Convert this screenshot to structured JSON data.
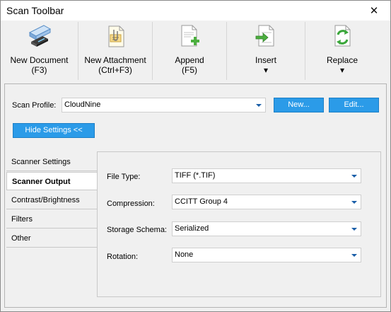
{
  "window": {
    "title": "Scan Toolbar"
  },
  "toolbar": {
    "buttons": [
      {
        "line1": "New Document",
        "line2": "(F3)",
        "icon": "scanner-icon"
      },
      {
        "line1": "New Attachment",
        "line2": "(Ctrl+F3)",
        "icon": "attachment-icon"
      },
      {
        "line1": "Append",
        "line2": "(F5)",
        "icon": "append-document-icon"
      },
      {
        "line1": "Insert",
        "line2": "▾",
        "icon": "insert-document-icon"
      },
      {
        "line1": "Replace",
        "line2": "▾",
        "icon": "replace-document-icon"
      }
    ]
  },
  "profile": {
    "label": "Scan Profile:",
    "value": "CloudNine",
    "new_label": "New...",
    "edit_label": "Edit...",
    "hide_settings_label": "Hide Settings <<"
  },
  "tabs": [
    {
      "label": "Scanner Settings",
      "active": false
    },
    {
      "label": "Scanner Output",
      "active": true
    },
    {
      "label": "Contrast/Brightness",
      "active": false
    },
    {
      "label": "Filters",
      "active": false
    },
    {
      "label": "Other",
      "active": false
    }
  ],
  "settings": {
    "file_type": {
      "label": "File Type:",
      "value": "TIFF (*.TIF)"
    },
    "compression": {
      "label": "Compression:",
      "value": "CCITT Group 4"
    },
    "storage_schema": {
      "label": "Storage Schema:",
      "value": "Serialized"
    },
    "rotation": {
      "label": "Rotation:",
      "value": "None"
    }
  },
  "colors": {
    "accent_button": "#2b9be8",
    "dropdown_arrow": "#1a5ea8"
  }
}
